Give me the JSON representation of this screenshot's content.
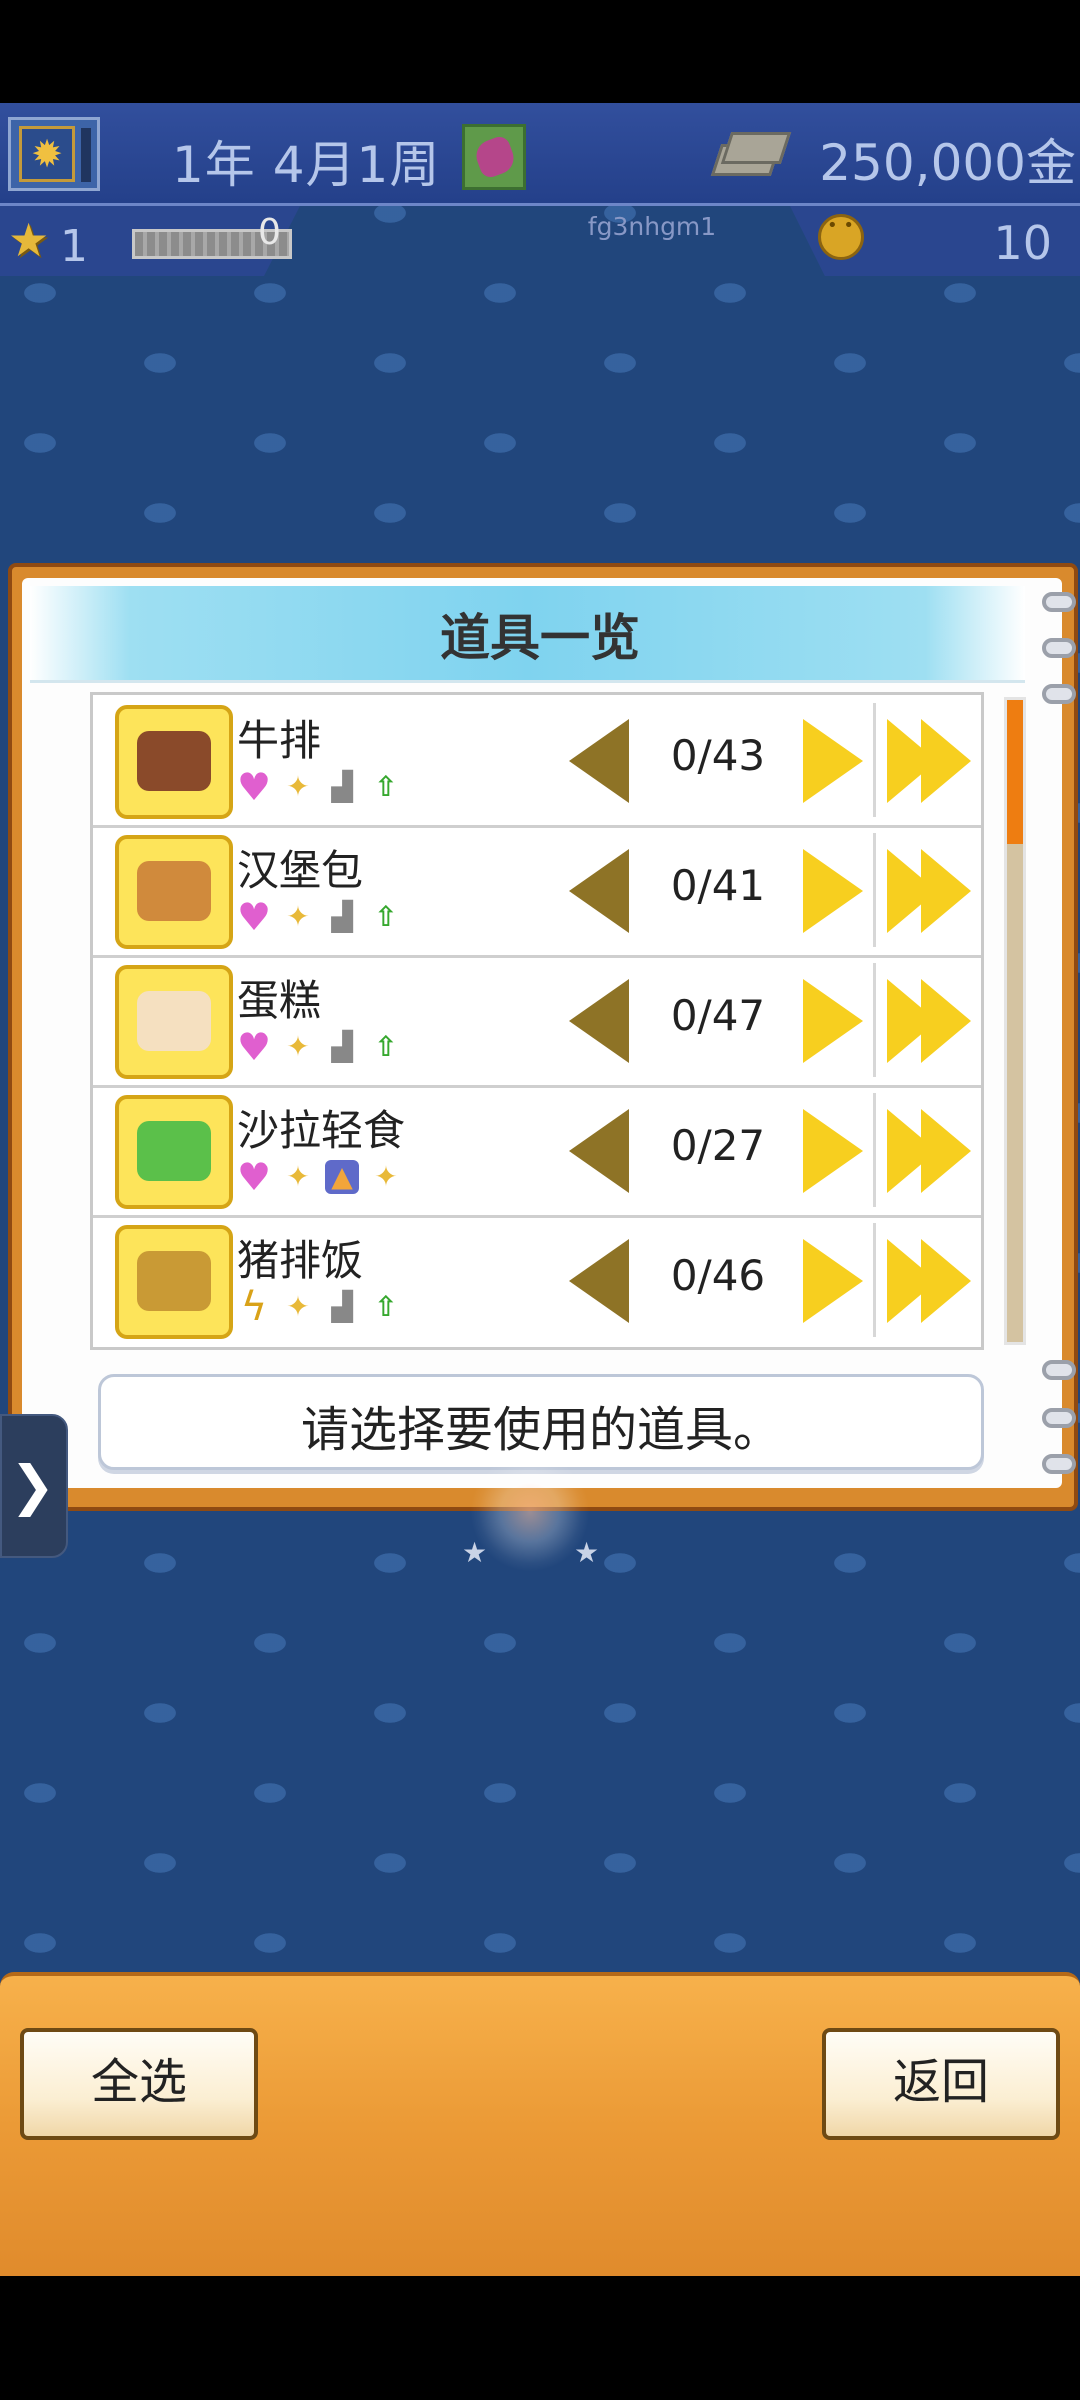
{
  "hud": {
    "date": "1年 4月1周",
    "money": "250,000金",
    "level": "1",
    "exp": "0",
    "username": "fg3nhgm1",
    "points": "10"
  },
  "panel": {
    "title": "道具一览",
    "message": "请选择要使用的道具。",
    "items": [
      {
        "name": "牛排",
        "count": "0/43",
        "stats": [
          "heart-icon",
          "spark-icon",
          "bag-icon",
          "up-arrow-icon"
        ],
        "food_color": "#8a4a2a"
      },
      {
        "name": "汉堡包",
        "count": "0/41",
        "stats": [
          "heart-icon",
          "spark-icon",
          "bag-icon",
          "up-arrow-icon"
        ],
        "food_color": "#d08a3c"
      },
      {
        "name": "蛋糕",
        "count": "0/47",
        "stats": [
          "heart-icon",
          "spark-icon",
          "bag-icon",
          "up-arrow-icon"
        ],
        "food_color": "#f5e0c0"
      },
      {
        "name": "沙拉轻食",
        "count": "0/27",
        "stats": [
          "heart-icon",
          "spark-icon",
          "fire-icon",
          "spark-icon"
        ],
        "food_color": "#5bc04a"
      },
      {
        "name": "猪排饭",
        "count": "0/46",
        "stats": [
          "bolt-icon",
          "spark-icon",
          "bag-icon",
          "up-arrow-icon"
        ],
        "food_color": "#c99a35"
      }
    ]
  },
  "buttons": {
    "select_all": "全选",
    "back": "返回"
  },
  "colors": {
    "background": "#21467c",
    "hud": "#2a468f",
    "panel_border": "#d98a2d",
    "icon_yellow": "#fde45a",
    "arrow_yellow": "#f7cf1f",
    "scroll_thumb": "#ee7d11",
    "bottom_bar": "#eb9a36"
  },
  "scroll": {
    "position": 0.0
  }
}
